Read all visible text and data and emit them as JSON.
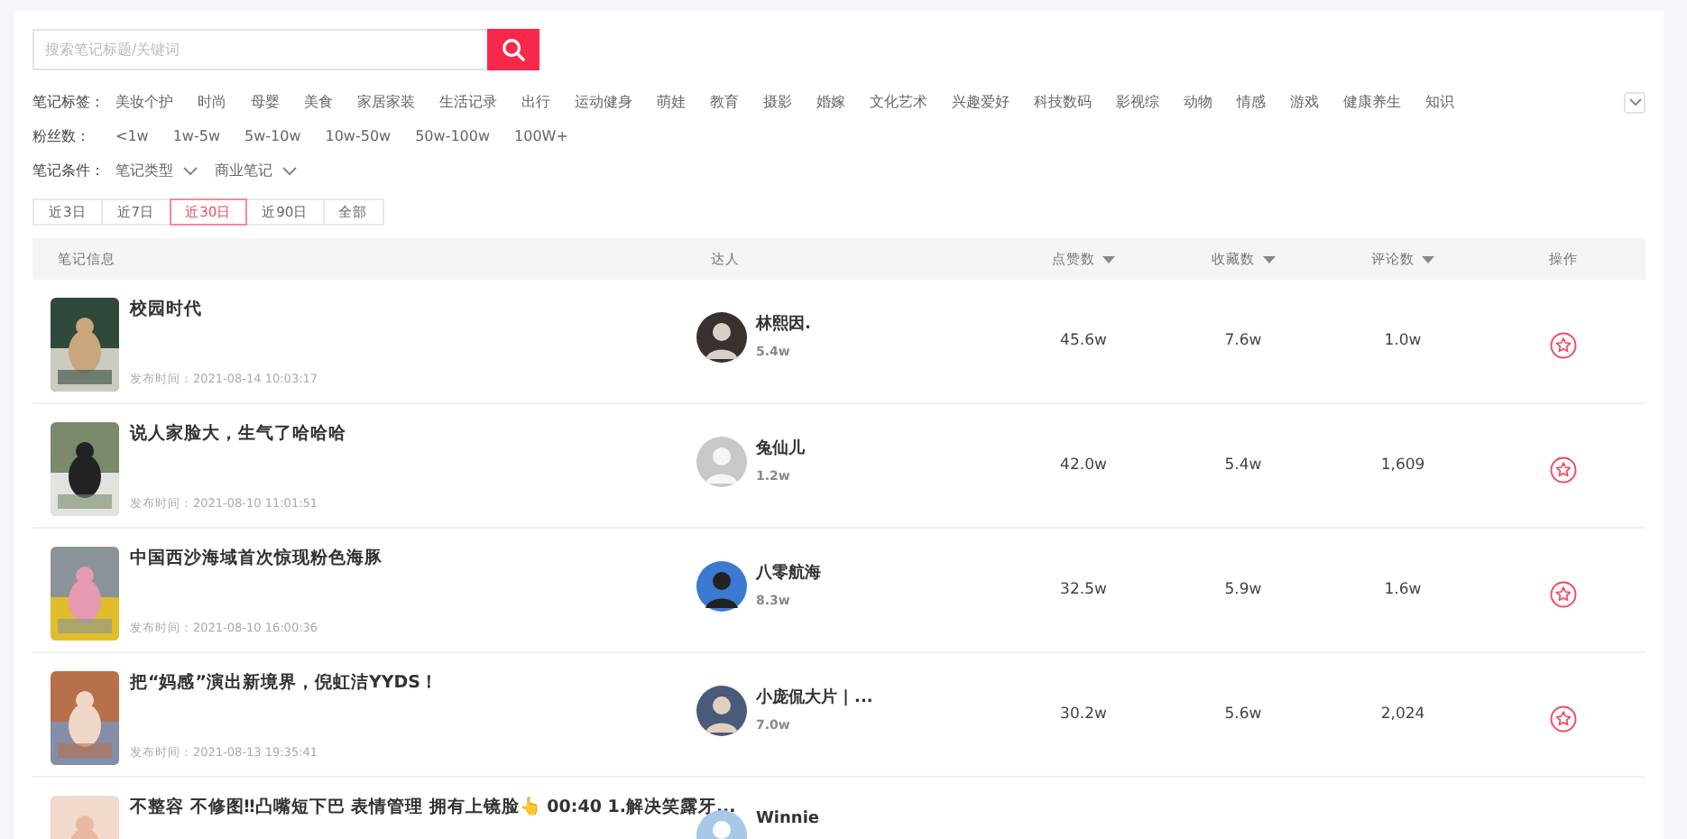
{
  "search": {
    "placeholder": "搜索笔记标题/关键词"
  },
  "filters": [
    {
      "label": "笔记标签：",
      "kind": "options",
      "options": [
        "美妆个护",
        "时尚",
        "母婴",
        "美食",
        "家居家装",
        "生活记录",
        "出行",
        "运动健身",
        "萌娃",
        "教育",
        "摄影",
        "婚嫁",
        "文化艺术",
        "兴趣爱好",
        "科技数码",
        "影视综",
        "动物",
        "情感",
        "游戏",
        "健康养生",
        "知识"
      ],
      "expandable": true
    },
    {
      "label": "粉丝数：",
      "kind": "options",
      "options": [
        "<1w",
        "1w-5w",
        "5w-10w",
        "10w-50w",
        "50w-100w",
        "100W+"
      ],
      "expandable": false
    },
    {
      "label": "笔记条件：",
      "kind": "dropdowns",
      "options": [
        "笔记类型",
        "商业笔记"
      ],
      "expandable": false
    }
  ],
  "periods": [
    {
      "label": "近3日",
      "selected": false
    },
    {
      "label": "近7日",
      "selected": false
    },
    {
      "label": "近30日",
      "selected": true
    },
    {
      "label": "近90日",
      "selected": false
    },
    {
      "label": "全部",
      "selected": false
    }
  ],
  "table": {
    "columns": [
      {
        "label": "笔记信息",
        "sortable": false
      },
      {
        "label": "达人",
        "sortable": false
      },
      {
        "label": "点赞数",
        "sortable": true
      },
      {
        "label": "收藏数",
        "sortable": true
      },
      {
        "label": "评论数",
        "sortable": true
      },
      {
        "label": "操作",
        "sortable": false
      }
    ],
    "rows": [
      {
        "title": "校园时代",
        "published": "发布时间：2021-08-14 10:03:17",
        "author": "林熙因.",
        "followers": "5.4w",
        "likes": "45.6w",
        "favorites": "7.6w",
        "comments": "1.0w"
      },
      {
        "title": "说人家脸大，生气了哈哈哈",
        "published": "发布时间：2021-08-10 11:01:51",
        "author": "兔仙儿",
        "followers": "1.2w",
        "likes": "42.0w",
        "favorites": "5.4w",
        "comments": "1,609"
      },
      {
        "title": "中国西沙海域首次惊现粉色海豚",
        "published": "发布时间：2021-08-10 16:00:36",
        "author": "八零航海",
        "followers": "8.3w",
        "likes": "32.5w",
        "favorites": "5.9w",
        "comments": "1.6w"
      },
      {
        "title": "把“妈感”演出新境界，倪虹洁YYDS！",
        "published": "发布时间：2021-08-13 19:35:41",
        "author": "小庞侃大片 | ...",
        "followers": "7.0w",
        "likes": "30.2w",
        "favorites": "5.6w",
        "comments": "2,024"
      },
      {
        "title": "不整容 不修图‼凸嘴短下巴 表情管理 拥有上镜脸👆 00:40 1.解决笑露牙...",
        "author": "Winnie"
      }
    ]
  }
}
